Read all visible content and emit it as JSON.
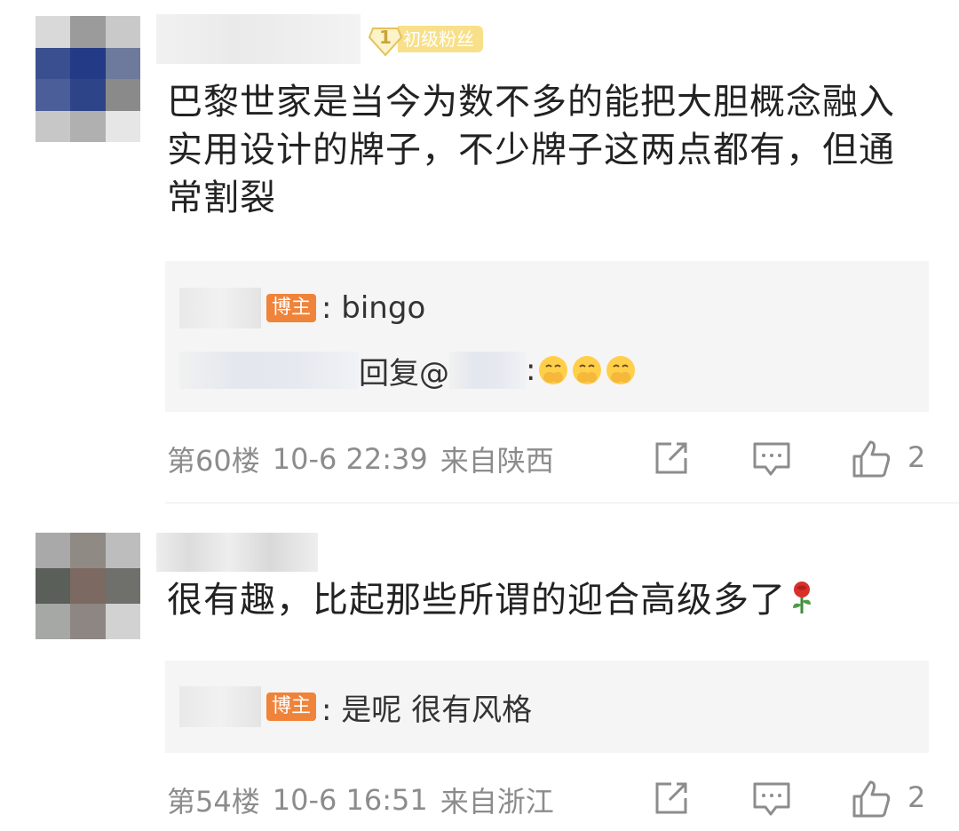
{
  "comments": [
    {
      "fan_badge": {
        "level": "1",
        "label": "初级粉丝"
      },
      "text": "巴黎世家是当今为数不多的能把大胆概念融入实用设计的牌子，不少牌子这两点都有，但通常割裂",
      "replies": [
        {
          "tag": "博主",
          "text": ": bingo"
        },
        {
          "prefix": "回复@",
          "suffix": ":"
        }
      ],
      "meta": {
        "floor": "第60楼",
        "time": "10-6 22:39",
        "location": "来自陕西"
      },
      "likes": "2"
    },
    {
      "text": "很有趣，比起那些所谓的迎合高级多了",
      "replies": [
        {
          "tag": "博主",
          "text": ": 是呢 很有风格"
        }
      ],
      "meta": {
        "floor": "第54楼",
        "time": "10-6 16:51",
        "location": "来自浙江"
      },
      "likes": "2"
    }
  ],
  "icons": [
    "share-icon",
    "reply-icon",
    "like-icon",
    "rose-emoji",
    "hand-over-mouth-emoji",
    "fan-level-diamond-icon"
  ],
  "colors": {
    "blogger_tag": "#f0833a",
    "fan_badge": "#f8e08a",
    "meta_text": "#8c8c8c",
    "reply_bg": "#f5f5f5"
  }
}
